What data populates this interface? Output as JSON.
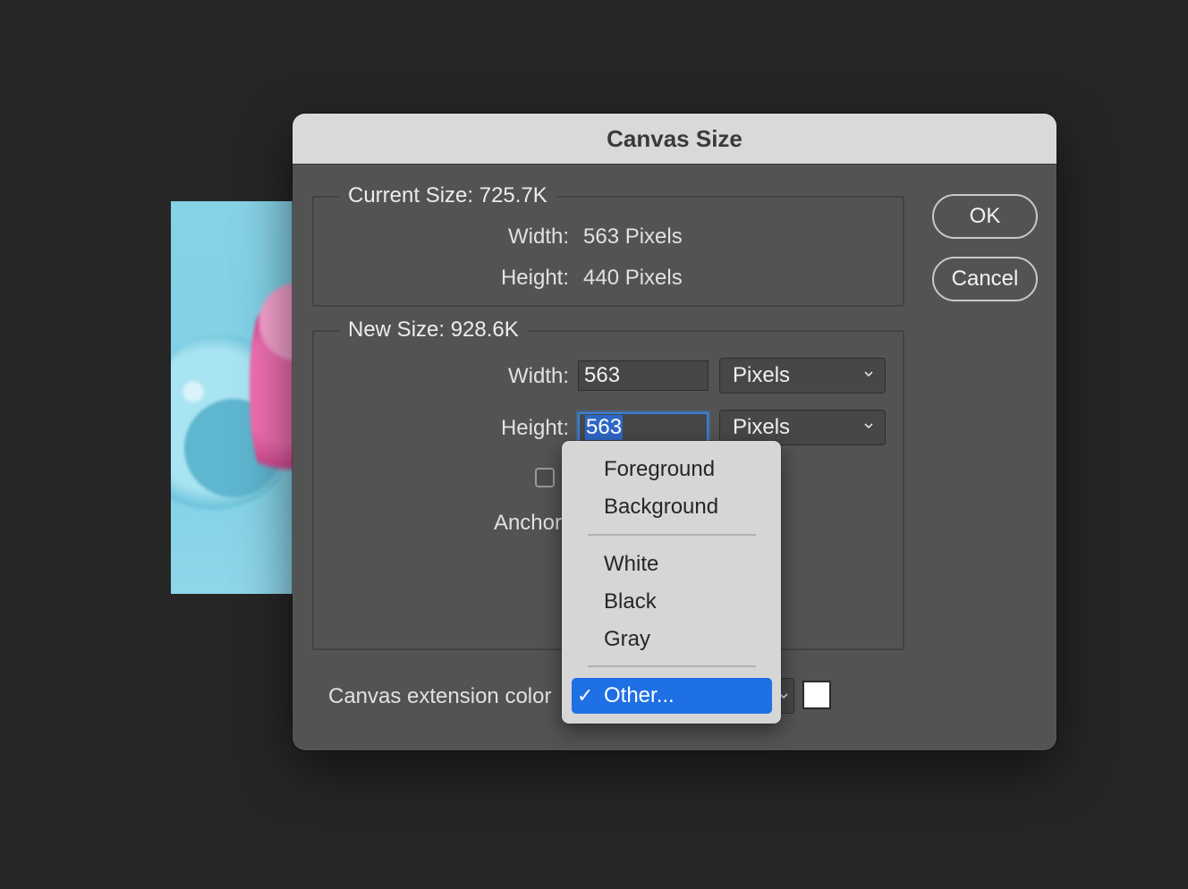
{
  "dialog": {
    "title": "Canvas Size",
    "current_size": {
      "legend": "Current Size: 725.7K",
      "width_label": "Width:",
      "width_value": "563 Pixels",
      "height_label": "Height:",
      "height_value": "440 Pixels"
    },
    "new_size": {
      "legend": "New Size: 928.6K",
      "width_label": "Width:",
      "width_value": "563",
      "width_unit": "Pixels",
      "height_label": "Height:",
      "height_value": "563",
      "height_unit": "Pixels",
      "anchor_label": "Anchor"
    },
    "buttons": {
      "ok": "OK",
      "cancel": "Cancel"
    },
    "canvas_extension_label": "Canvas extension color",
    "canvas_extension_swatch": "#ffffff"
  },
  "menu": {
    "items_top": [
      "Foreground",
      "Background"
    ],
    "items_middle": [
      "White",
      "Black",
      "Gray"
    ],
    "selected": "Other...",
    "check": "✓"
  },
  "colors": {
    "accent": "#1f6fe5",
    "dialog_bg": "#535353",
    "titlebar_bg": "#d9d9d9",
    "desktop_bg": "#262626"
  }
}
